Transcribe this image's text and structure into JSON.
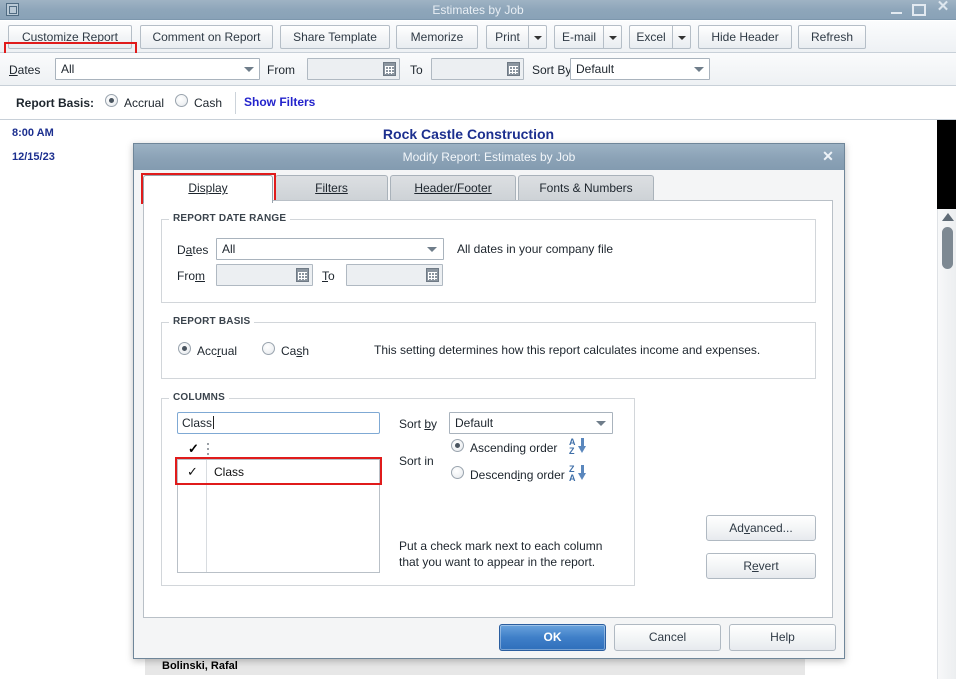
{
  "window": {
    "title": "Estimates by Job",
    "minimize_label": "minimize",
    "maximize_label": "maximize",
    "close_label": "✕"
  },
  "toolbar": {
    "buttons": [
      {
        "label": "Customize Report",
        "accel": "m",
        "highlighted": true
      },
      {
        "label": "Comment on Report",
        "accel": "t"
      },
      {
        "label": "Share Template",
        "accel": ""
      },
      {
        "label": "Memorize",
        "accel": "z"
      },
      {
        "label": "Print",
        "accel": "t",
        "split": true
      },
      {
        "label": "E-mail",
        "accel": "i",
        "split": true
      },
      {
        "label": "Excel",
        "accel": "x",
        "split": true
      },
      {
        "label": "Hide Header",
        "accel": "d"
      },
      {
        "label": "Refresh",
        "accel": "h"
      }
    ]
  },
  "filterbar": {
    "dates_label": "Dates",
    "dates_value": "All",
    "from_label": "From",
    "from_value": "",
    "to_label": "To",
    "to_value": "",
    "sortby_label": "Sort By",
    "sortby_value": "Default"
  },
  "basisbar": {
    "label": "Report Basis:",
    "accrual_label": "Accrual",
    "cash_label": "Cash",
    "selected": "Accrual",
    "show_filters_label": "Show Filters"
  },
  "report": {
    "time": "8:00 AM",
    "date": "12/15/23",
    "company": "Rock Castle Construction",
    "row_label": "Bolinski, Rafal"
  },
  "dialog": {
    "title": "Modify Report: Estimates by Job",
    "close_label": "✕",
    "tabs": [
      {
        "label": "Display",
        "accel": "D",
        "active": true
      },
      {
        "label": "Filters",
        "accel": "F",
        "active": false
      },
      {
        "label": "Header/Footer",
        "accel": "H",
        "active": false
      },
      {
        "label": "Fonts & Numbers",
        "accel": "n",
        "active": false
      }
    ],
    "date_range": {
      "group_title": "REPORT DATE RANGE",
      "dates_label": "Dates",
      "dates_value": "All",
      "dates_hint": "All dates in your company file",
      "from_label": "From",
      "from_value": "",
      "to_label": "To",
      "to_value": ""
    },
    "report_basis": {
      "group_title": "REPORT BASIS",
      "accrual_label": "Accrual",
      "cash_label": "Cash",
      "selected": "Accrual",
      "hint": "This setting determines how this report calculates income and expenses."
    },
    "columns": {
      "group_title": "COLUMNS",
      "search_value": "Class",
      "search_placeholder": "",
      "header_check": "✓",
      "items": [
        {
          "checked": true,
          "check_glyph": "✓",
          "label": "Class",
          "highlighted": true
        }
      ],
      "sort_by_label": "Sort by",
      "sort_by_value": "Default",
      "sort_in_label": "Sort in",
      "ascending_label": "Ascending order",
      "ascending_accel": "g",
      "descending_label": "Descending order",
      "descending_accel": "i",
      "sort_order_selected": "Ascending order",
      "asc_icon_top": "A",
      "asc_icon_bottom": "Z",
      "desc_icon_top": "Z",
      "desc_icon_bottom": "A",
      "hint_line1": "Put a check mark next to each column",
      "hint_line2": "that you want to appear in the report."
    },
    "side_buttons": [
      {
        "label": "Advanced...",
        "accel": "v"
      },
      {
        "label": "Revert",
        "accel": "e"
      }
    ],
    "footer_buttons": [
      {
        "label": "OK",
        "primary": true
      },
      {
        "label": "Cancel",
        "primary": false
      },
      {
        "label": "Help",
        "primary": false
      }
    ]
  },
  "colors": {
    "highlight_red": "#e01b1b",
    "title_blue": "#1c2f8f",
    "primary_button": "#2f6fbb",
    "link_blue": "#2323cc"
  }
}
